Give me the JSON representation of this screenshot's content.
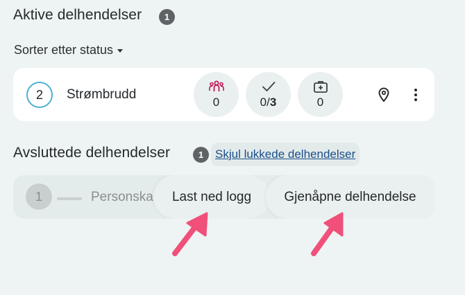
{
  "active": {
    "title": "Aktive delhendelser",
    "count": "1",
    "sort_label": "Sorter etter status",
    "incident": {
      "number": "2",
      "name": "Strømbrudd",
      "persons": "0",
      "tasks_done": "0/",
      "tasks_total": "3",
      "medical": "0"
    }
  },
  "closed": {
    "title": "Avsluttede delhendelser",
    "count": "1",
    "toggle_link": "Skjul lukkede delhendelser",
    "incident": {
      "number": "1",
      "name_partial": "Personska"
    },
    "actions": {
      "download_log": "Last ned logg",
      "reopen": "Gjenåpne delhendelse"
    }
  },
  "colors": {
    "accent_circle": "#4bb3d1",
    "persons_icon": "#c2185b",
    "arrow": "#f0507a"
  },
  "icons": [
    "persons-icon",
    "checkmark-icon",
    "medical-kit-icon",
    "location-pin-icon",
    "more-vertical-icon",
    "caret-down-icon"
  ]
}
